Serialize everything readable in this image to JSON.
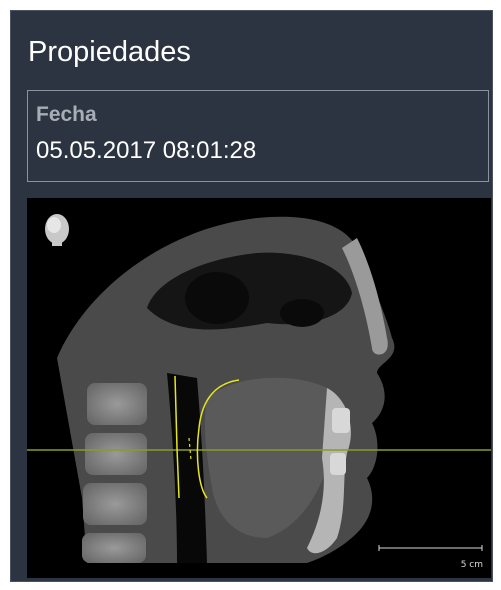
{
  "panel": {
    "title": "Propiedades",
    "date_field": {
      "label": "Fecha",
      "value": "05.05.2017 08:01:28"
    }
  },
  "viewer": {
    "orientation_icon": "head-orientation-icon",
    "scale_label": "5 cm",
    "colors": {
      "background": "#000000",
      "reference_line": "#8a9a2a",
      "curve": "#e6e61e"
    }
  }
}
